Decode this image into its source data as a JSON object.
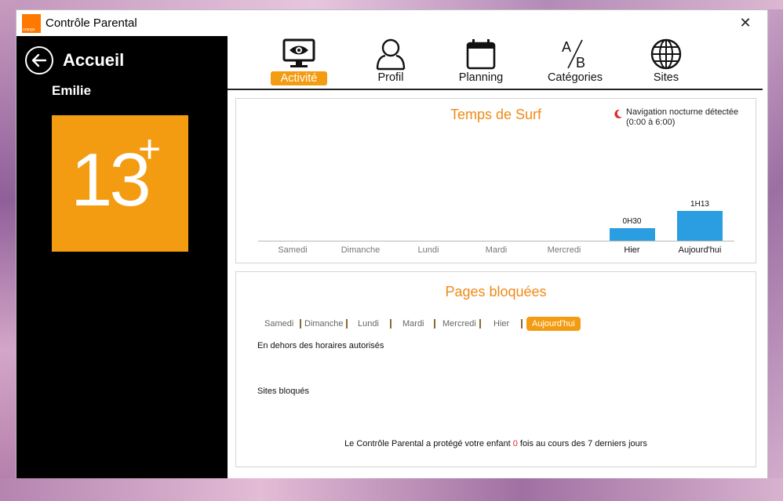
{
  "window": {
    "title": "Contrôle Parental",
    "logo_text": "orange",
    "close_label": "✕"
  },
  "sidebar": {
    "home_label": "Accueil",
    "child_name": "Emilie",
    "age_rating": "13",
    "age_plus": "+",
    "accent_color": "#f39c12"
  },
  "tabs": [
    {
      "label": "Activité",
      "icon": "monitor-eye-icon",
      "active": true
    },
    {
      "label": "Profil",
      "icon": "user-icon",
      "active": false
    },
    {
      "label": "Planning",
      "icon": "calendar-icon",
      "active": false
    },
    {
      "label": "Catégories",
      "icon": "a-slash-b-icon",
      "active": false
    },
    {
      "label": "Sites",
      "icon": "globe-icon",
      "active": false
    }
  ],
  "surf": {
    "title": "Temps de Surf",
    "night_note_line1": "Navigation nocturne détectée",
    "night_note_line2": "(0:00 à 6:00)",
    "bar_color": "#2a9ee0"
  },
  "chart_data": {
    "type": "bar",
    "title": "Temps de Surf",
    "categories": [
      "Samedi",
      "Dimanche",
      "Lundi",
      "Mardi",
      "Mercredi",
      "Hier",
      "Aujourd'hui"
    ],
    "values_minutes": [
      0,
      0,
      0,
      0,
      0,
      30,
      73
    ],
    "data_labels": [
      "",
      "",
      "",
      "",
      "",
      "0H30",
      "1H13"
    ]
  },
  "blocked": {
    "title": "Pages bloquées",
    "days": [
      "Samedi",
      "Dimanche",
      "Lundi",
      "Mardi",
      "Mercredi",
      "Hier",
      "Aujourd'hui"
    ],
    "active_day": "Aujourd'hui",
    "outside_hours_label": "En dehors des horaires autorisés",
    "blocked_sites_label": "Sites bloqués",
    "footer_before": "Le Contrôle Parental a protégé votre enfant ",
    "footer_count": "0",
    "footer_after": " fois au cours des 7 derniers jours"
  }
}
